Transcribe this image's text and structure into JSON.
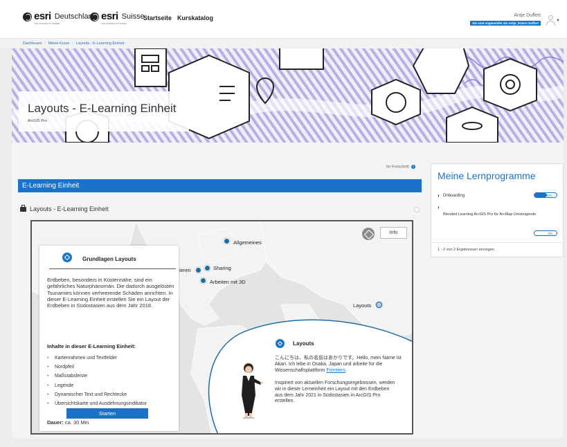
{
  "header": {
    "logos": [
      {
        "brand": "esri",
        "country": "Deutschland",
        "tagline": "THE SCIENCE OF WHERE"
      },
      {
        "brand": "esri",
        "country": "Suisse",
        "tagline": "THE SCIENCE OF WHERE"
      }
    ],
    "nav": [
      "Startseite",
      "Kurskatalog"
    ],
    "user_name": "Antje Duffert",
    "login_badge": "Sie sind angemeldet als Antje_Extern Duffert"
  },
  "breadcrumb": [
    "Dashboard",
    "Meine Kurse",
    "Layouts - E-Learning Einheit"
  ],
  "banner": {
    "title": "Layouts - E-Learning Einheit",
    "subtitle": "ArcGIS Pro"
  },
  "progress_label": "Ihr Fortschritt:",
  "section_heading": "E-Learning Einheit",
  "module_title": "Layouts - E-Learning Einheit",
  "map": {
    "info_button": "Info",
    "pins": [
      "Allgemeines",
      "Sharing",
      "Arbeiten mit 3D",
      "Layouts",
      "ieren"
    ]
  },
  "card": {
    "title": "Grundlagen Layouts",
    "description": "Erdbeben, besonders in Küstennähe, sind ein gefährliches Naturphänomän. Die dadurch ausgelösten Tsunamies können verheerende Schäden anrichten. In dieser E-Learning Einheit erstellen Sie ein Layout der Erdbeben in Südostasien aus dem Jahr 2018.",
    "contents_heading": "Inhalte in dieser E-Learning Einheit:",
    "contents": [
      "Kartenrahmen und Textfelder",
      "Nordpfeil",
      "Maßstabsleiste",
      "Legende",
      "Dynamischer Text und Rechtecke",
      "Übersichtskarte und Ausdehnungsindikator"
    ],
    "duration_label": "Dauer:",
    "duration_value": " ca. 30 Min.",
    "start_button": "Starten"
  },
  "bubble": {
    "title": "Layouts",
    "intro": "こんにちは、私の名前はあかりです。Hello, mein Name ist Akari. Ich lebe in Osaka, Japan und arbeite für die Wissenschaftsplattform ",
    "link": "Frontiers",
    "intro_end": ".",
    "body": "Inspiriert von aktuellen Forschungsergebnissen, werden wir in dieser Lerneinheit ein Layout mit den Erdbeben aus dem Jahr 2021 in Südostasien in ArcGIS Pro erstellen."
  },
  "learning_panel": {
    "title": "Meine Lernprogramme",
    "programs": [
      {
        "name": "Onboarding",
        "progress_pct": 33,
        "progress_label": "33%"
      },
      {
        "name": "Blended Learning ArcGIS Pro für ArcMap Umsteigende",
        "progress_pct": 0,
        "progress_label": "0%"
      }
    ],
    "result_count": "1 - 2 von 2 Ergebnissen anzeigen"
  },
  "colors": {
    "accent": "#1a73c8",
    "banner_line": "#8c7ad9"
  }
}
